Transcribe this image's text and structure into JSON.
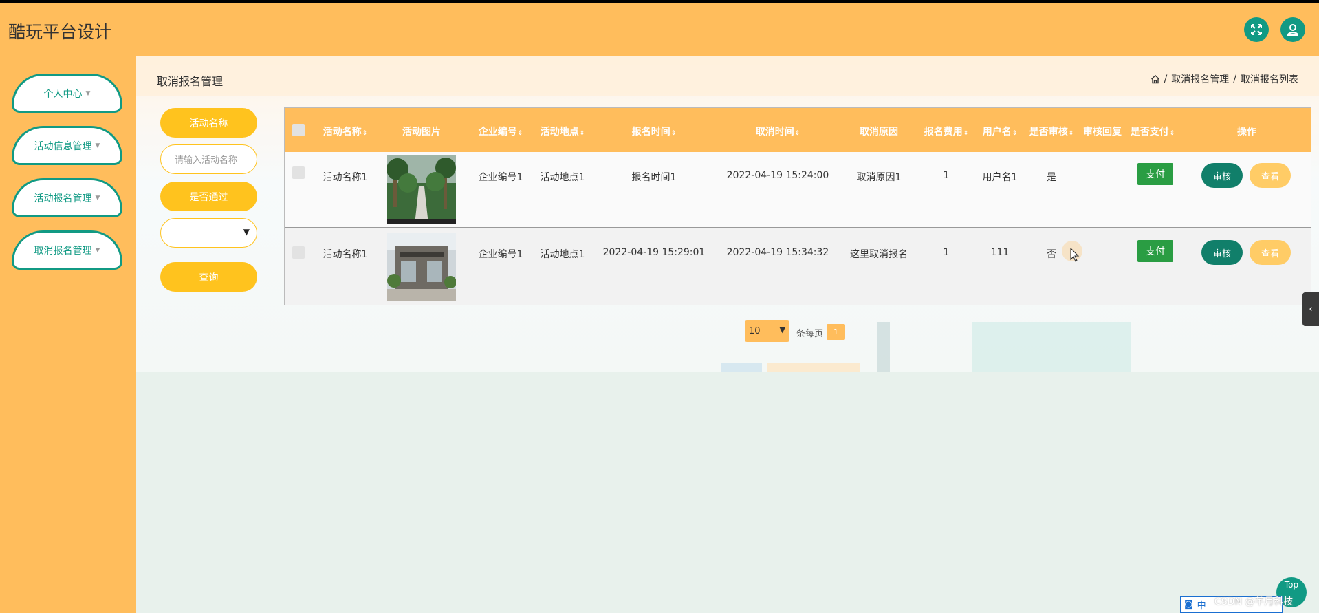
{
  "app": {
    "title": "酷玩平台设计",
    "accent_color": "#ffbd5c",
    "primary_color": "#119a84"
  },
  "header": {
    "fullscreen_icon": "expand-arrows-icon",
    "user_icon": "user-icon"
  },
  "sidebar": {
    "items": [
      {
        "label": "个人中心"
      },
      {
        "label": "活动信息管理"
      },
      {
        "label": "活动报名管理"
      },
      {
        "label": "取消报名管理"
      }
    ]
  },
  "page": {
    "title": "取消报名管理",
    "breadcrumb": [
      "取消报名管理",
      "取消报名列表"
    ]
  },
  "filters": {
    "activity_name_label": "活动名称",
    "activity_name_placeholder": "请输入活动名称",
    "passed_label": "是否通过",
    "passed_value": "",
    "query_button": "查询"
  },
  "table": {
    "columns": [
      "活动名称",
      "活动图片",
      "企业编号",
      "活动地点",
      "报名时间",
      "取消时间",
      "取消原因",
      "报名费用",
      "用户名",
      "是否审核",
      "审核回复",
      "是否支付",
      "操作"
    ],
    "rows": [
      {
        "activity_name": "活动名称1",
        "company_no": "企业编号1",
        "location": "活动地点1",
        "signup_time": "报名时间1",
        "cancel_time": "2022-04-19 15:24:00",
        "cancel_reason": "取消原因1",
        "fee": "1",
        "username": "用户名1",
        "reviewed": "是",
        "review_reply": "",
        "pay_label": "支付",
        "review_label": "审核",
        "view_label": "查看"
      },
      {
        "activity_name": "活动名称1",
        "company_no": "企业编号1",
        "location": "活动地点1",
        "signup_time": "2022-04-19 15:29:01",
        "cancel_time": "2022-04-19 15:34:32",
        "cancel_reason": "这里取消报名",
        "fee": "1",
        "username": "111",
        "reviewed": "否",
        "review_reply": "",
        "pay_label": "支付",
        "review_label": "审核",
        "view_label": "查看"
      }
    ]
  },
  "pagination": {
    "page_size": "10",
    "per_page_text": "条每页",
    "current_page": "1"
  },
  "floating": {
    "top_label": "Top",
    "watermark": "CSDN @芊月科技",
    "ime_text": "中"
  }
}
